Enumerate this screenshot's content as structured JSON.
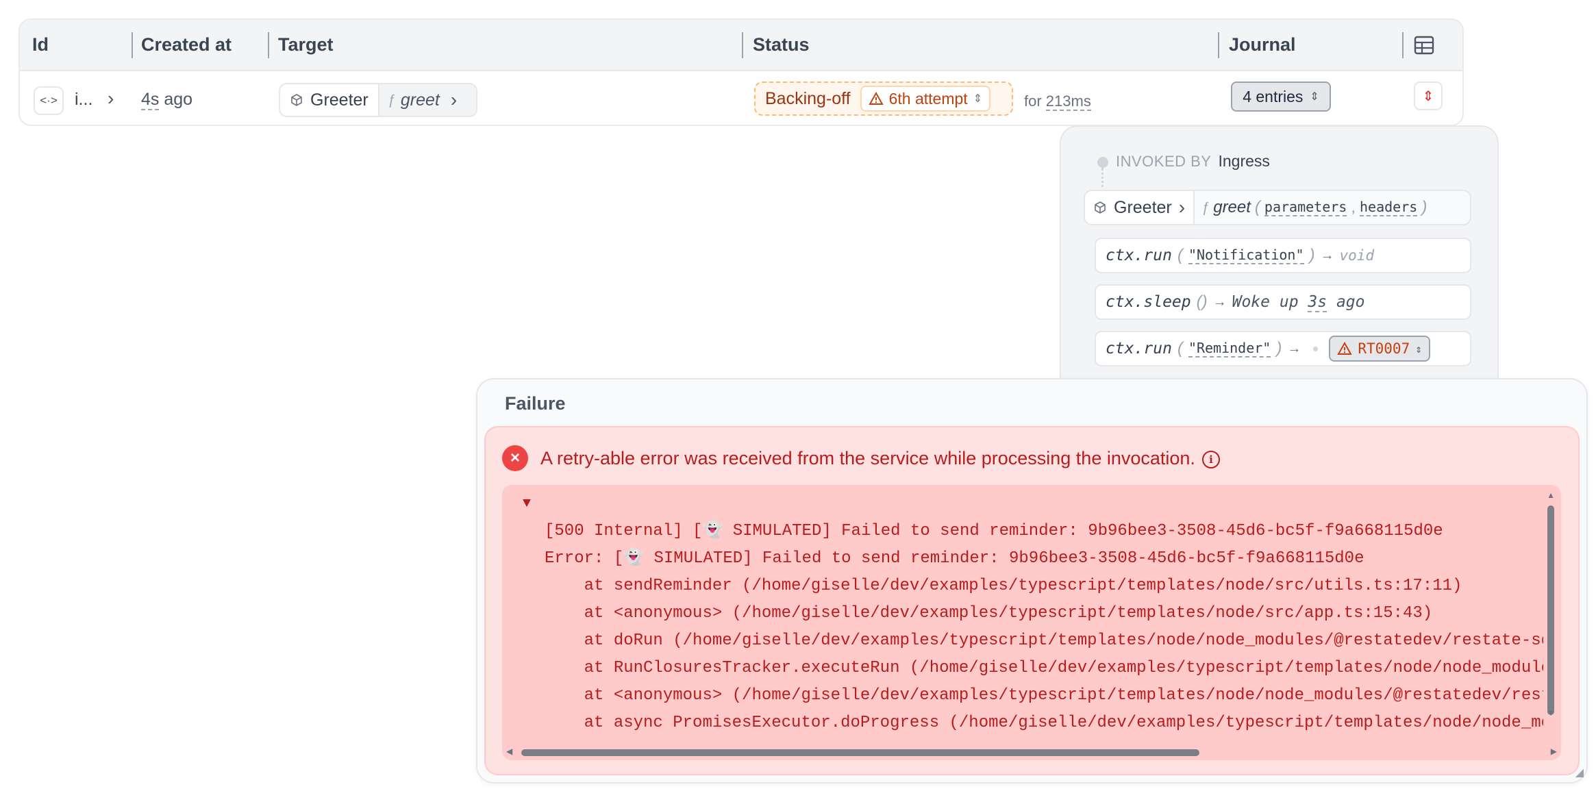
{
  "table": {
    "columns": [
      "Id",
      "Created at",
      "Target",
      "Status",
      "Journal"
    ],
    "row": {
      "id_icon": "<·>",
      "id_text": "i...",
      "created_value": "4s",
      "created_suffix": " ago",
      "target_service": "Greeter",
      "target_handler": "greet",
      "status": "Backing-off",
      "attempt": "6th attempt",
      "for_prefix": "for ",
      "for_duration": "213ms",
      "journal_entries": "4 entries"
    }
  },
  "journal": {
    "invoked_by_label": "INVOKED BY",
    "invoked_by_value": "Ingress",
    "main": {
      "service": "Greeter",
      "handler": "greet",
      "params": [
        "parameters",
        "headers"
      ]
    },
    "entries": [
      {
        "call": "ctx.run",
        "arg": "\"Notification\"",
        "result": "void"
      },
      {
        "call": "ctx.sleep",
        "result_prefix": "Woke up ",
        "result_value": "3s",
        "result_suffix": " ago"
      },
      {
        "call": "ctx.run",
        "arg": "\"Reminder\"",
        "error_code": "RT0007"
      }
    ]
  },
  "failure": {
    "title": "Failure",
    "message": "A retry-able error was received from the service while processing the invocation.",
    "stack_lines": [
      "[500 Internal] [👻 SIMULATED] Failed to send reminder: 9b96bee3-3508-45d6-bc5f-f9a668115d0e",
      "Error: [👻 SIMULATED] Failed to send reminder: 9b96bee3-3508-45d6-bc5f-f9a668115d0e",
      "    at sendReminder (/home/giselle/dev/examples/typescript/templates/node/src/utils.ts:17:11)",
      "    at <anonymous> (/home/giselle/dev/examples/typescript/templates/node/src/app.ts:15:43)",
      "    at doRun (/home/giselle/dev/examples/typescript/templates/node/node_modules/@restatedev/restate-sdk/",
      "    at RunClosuresTracker.executeRun (/home/giselle/dev/examples/typescript/templates/node/node_modules/",
      "    at <anonymous> (/home/giselle/dev/examples/typescript/templates/node/node_modules/@restatedev/restat",
      "    at async PromisesExecutor.doProgress (/home/giselle/dev/examples/typescript/templates/node/node_modu"
    ]
  },
  "colors": {
    "backing_off": "#9a3412",
    "error": "#b91c1c",
    "error_bg": "#fee2e2"
  },
  "icons": [
    "code-icon",
    "chevron-right-icon",
    "box-icon",
    "function-icon",
    "warning-icon",
    "updown-icon",
    "table-layout-icon",
    "close-circle-icon",
    "info-icon"
  ]
}
